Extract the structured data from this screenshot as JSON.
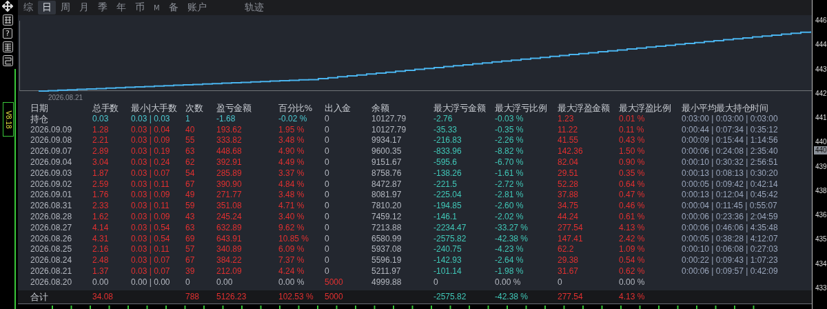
{
  "tabs": [
    {
      "label": "综",
      "selected": false
    },
    {
      "label": "日",
      "selected": true
    },
    {
      "label": "周",
      "selected": false
    },
    {
      "label": "月",
      "selected": false
    },
    {
      "label": "季",
      "selected": false
    },
    {
      "label": "年",
      "selected": false
    },
    {
      "label": "币",
      "selected": false
    },
    {
      "label": "M",
      "selected": false
    },
    {
      "label": "备",
      "selected": false
    },
    {
      "label": "账户",
      "selected": false
    }
  ],
  "right_tabs": [
    {
      "label": "轨迹",
      "selected": false
    }
  ],
  "side_toolbar": {
    "help_label": "?",
    "version": "V8.18"
  },
  "chart": {
    "x_label": "2026.08.21"
  },
  "price_axis": {
    "labels": [
      "446",
      "444",
      "443",
      "442",
      "441",
      "440",
      "439",
      "438",
      "436",
      "435",
      "434",
      "433"
    ],
    "current": "440"
  },
  "table": {
    "columns": [
      "日期",
      "总手数",
      "最小|大手数",
      "次数",
      "盈亏金额",
      "百分比%",
      "出入金",
      "余额",
      "最大浮亏金额",
      "最大浮亏比例",
      "最大浮盈金额",
      "最大浮盈比例",
      "最小平均最大持仓时间"
    ],
    "rows": [
      {
        "kind": "position",
        "cells": [
          "持仓",
          "0.03",
          "0.03 | 0.03",
          "1",
          "-1.68",
          "-0.02 %",
          "0",
          "10127.79",
          "-2.76",
          "-0.03 %",
          "1.23",
          "0.01 %",
          "0:03:00 | 0:03:00 | 0:03:00"
        ]
      },
      {
        "kind": "day",
        "cells": [
          "2026.09.09",
          "1.28",
          "0.03 | 0.04",
          "40",
          "193.62",
          "1.95 %",
          "0",
          "10127.79",
          "-35.33",
          "-0.35 %",
          "11.22",
          "0.11 %",
          "0:00:44 | 0:07:34 | 0:35:12"
        ]
      },
      {
        "kind": "day",
        "cells": [
          "2026.09.08",
          "2.21",
          "0.03 | 0.09",
          "55",
          "333.82",
          "3.48 %",
          "0",
          "9934.17",
          "-216.83",
          "-2.26 %",
          "41.55",
          "0.43 %",
          "0:00:09 | 0:15:44 | 1:14:56"
        ]
      },
      {
        "kind": "day",
        "cells": [
          "2026.09.07",
          "2.89",
          "0.03 | 0.19",
          "63",
          "448.68",
          "4.90 %",
          "0",
          "9600.35",
          "-833.96",
          "-8.82 %",
          "142.36",
          "1.50 %",
          "0:00:06 | 0:24:08 | 2:35:40"
        ]
      },
      {
        "kind": "day",
        "cells": [
          "2026.09.04",
          "3.04",
          "0.03 | 0.24",
          "62",
          "392.91",
          "4.49 %",
          "0",
          "9151.67",
          "-595.6",
          "-6.70 %",
          "82.04",
          "0.90 %",
          "0:00:10 | 0:30:32 | 2:56:51"
        ]
      },
      {
        "kind": "day",
        "cells": [
          "2026.09.03",
          "1.87",
          "0.03 | 0.07",
          "54",
          "285.89",
          "3.37 %",
          "0",
          "8758.76",
          "-138.26",
          "-1.61 %",
          "29.51",
          "0.35 %",
          "0:00:13 | 0:08:13 | 0:30:20"
        ]
      },
      {
        "kind": "day",
        "cells": [
          "2026.09.02",
          "2.59",
          "0.03 | 0.11",
          "67",
          "390.90",
          "4.84 %",
          "0",
          "8472.87",
          "-221.5",
          "-2.72 %",
          "52.28",
          "0.64 %",
          "0:00:05 | 0:09:42 | 0:42:14"
        ]
      },
      {
        "kind": "day",
        "cells": [
          "2026.09.01",
          "1.76",
          "0.03 | 0.09",
          "49",
          "271.77",
          "3.48 %",
          "0",
          "8081.97",
          "-225.04",
          "-2.81 %",
          "37.88",
          "0.47 %",
          "0:00:13 | 0:12:04 | 0:45:42"
        ]
      },
      {
        "kind": "day",
        "cells": [
          "2026.08.31",
          "2.33",
          "0.03 | 0.11",
          "59",
          "351.08",
          "4.71 %",
          "0",
          "7810.20",
          "-194.85",
          "-2.60 %",
          "34.75",
          "0.46 %",
          "0:00:04 | 0:11:45 | 0:55:07"
        ]
      },
      {
        "kind": "day",
        "cells": [
          "2026.08.28",
          "1.62",
          "0.03 | 0.09",
          "43",
          "245.24",
          "3.40 %",
          "0",
          "7459.12",
          "-146.1",
          "-2.02 %",
          "44.24",
          "0.61 %",
          "0:00:06 | 0:23:36 | 2:04:59"
        ]
      },
      {
        "kind": "day",
        "cells": [
          "2026.08.27",
          "4.14",
          "0.03 | 0.54",
          "63",
          "632.89",
          "9.62 %",
          "0",
          "7213.88",
          "-2234.47",
          "-33.27 %",
          "277.54",
          "4.13 %",
          "0:00:06 | 0:46:06 | 4:35:48"
        ]
      },
      {
        "kind": "day",
        "cells": [
          "2026.08.26",
          "4.31",
          "0.03 | 0.54",
          "69",
          "643.91",
          "10.85 %",
          "0",
          "6580.99",
          "-2575.82",
          "-42.38 %",
          "147.41",
          "2.42 %",
          "0:00:05 | 0:38:28 | 4:12:07"
        ]
      },
      {
        "kind": "day",
        "cells": [
          "2026.08.25",
          "2.16",
          "0.03 | 0.11",
          "57",
          "340.89",
          "6.09 %",
          "0",
          "5937.08",
          "-240.75",
          "-4.23 %",
          "62.2",
          "1.09 %",
          "0:00:10 | 0:06:08 | 0:27:03"
        ]
      },
      {
        "kind": "day",
        "cells": [
          "2026.08.24",
          "2.48",
          "0.03 | 0.07",
          "67",
          "384.22",
          "7.37 %",
          "0",
          "5596.19",
          "-142.93",
          "-2.64 %",
          "29.38",
          "0.54 %",
          "0:00:22 | 0:09:43 | 1:07:23"
        ]
      },
      {
        "kind": "day",
        "cells": [
          "2026.08.21",
          "1.37",
          "0.03 | 0.07",
          "39",
          "212.09",
          "4.24 %",
          "0",
          "5211.97",
          "-101.14",
          "-1.98 %",
          "31.67",
          "0.62 %",
          "0:00:06 | 0:09:57 | 0:42:09"
        ]
      },
      {
        "kind": "deposit",
        "cells": [
          "2026.08.20",
          "0.00",
          "0.00 | 0.00",
          "0",
          "0.00",
          "0.00 %",
          "5000",
          "4999.88",
          "0",
          "0.00 %",
          "0",
          "0.00 %",
          null
        ]
      },
      {
        "kind": "total",
        "cells": [
          "合计",
          "34.08",
          null,
          "788",
          "5126.23",
          "102.53 %",
          "5000",
          null,
          "-2575.82",
          "-42.38 %",
          "277.54",
          "4.13 %",
          null
        ]
      }
    ]
  }
}
